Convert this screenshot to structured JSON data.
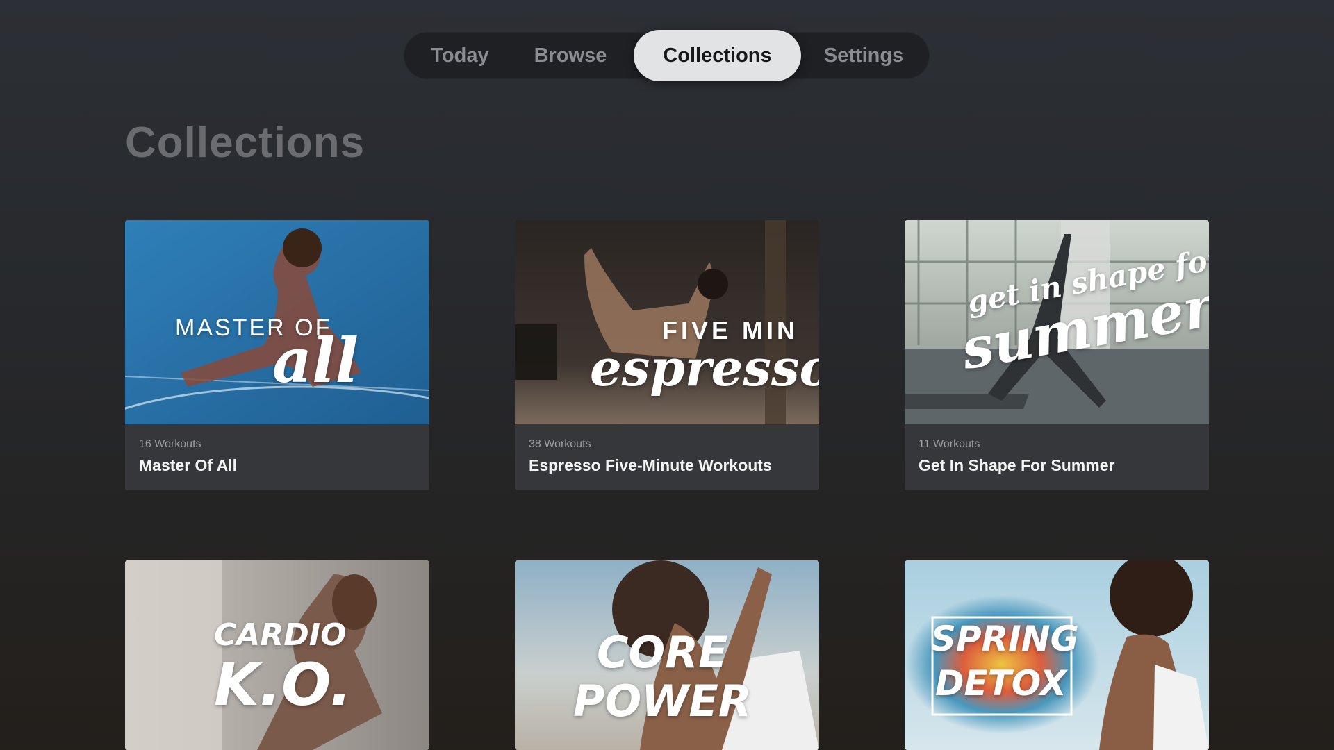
{
  "nav": {
    "tabs": [
      {
        "label": "Today",
        "active": false
      },
      {
        "label": "Browse",
        "active": false
      },
      {
        "label": "Collections",
        "active": true
      },
      {
        "label": "Settings",
        "active": false
      }
    ]
  },
  "page": {
    "title": "Collections"
  },
  "collections": [
    {
      "count": "16 Workouts",
      "name": "Master Of All",
      "art_line1": "MASTER OF",
      "art_line2": "all"
    },
    {
      "count": "38 Workouts",
      "name": "Espresso Five-Minute Workouts",
      "art_line1": "FIVE MIN",
      "art_line2": "espresso"
    },
    {
      "count": "11 Workouts",
      "name": "Get In Shape For Summer",
      "art_line1": "get in shape for",
      "art_line2": "summer"
    },
    {
      "art_line1": "CARDIO",
      "art_line2": "K.O."
    },
    {
      "art_line1": "CORE",
      "art_line2": "POWER"
    },
    {
      "art_line1": "SPRING",
      "art_line2": "DETOX"
    }
  ],
  "colors": {
    "nav_active_bg": "#e2e3e5",
    "card_meta_bg": "#36373b",
    "title_gray": "#6a6c70"
  }
}
